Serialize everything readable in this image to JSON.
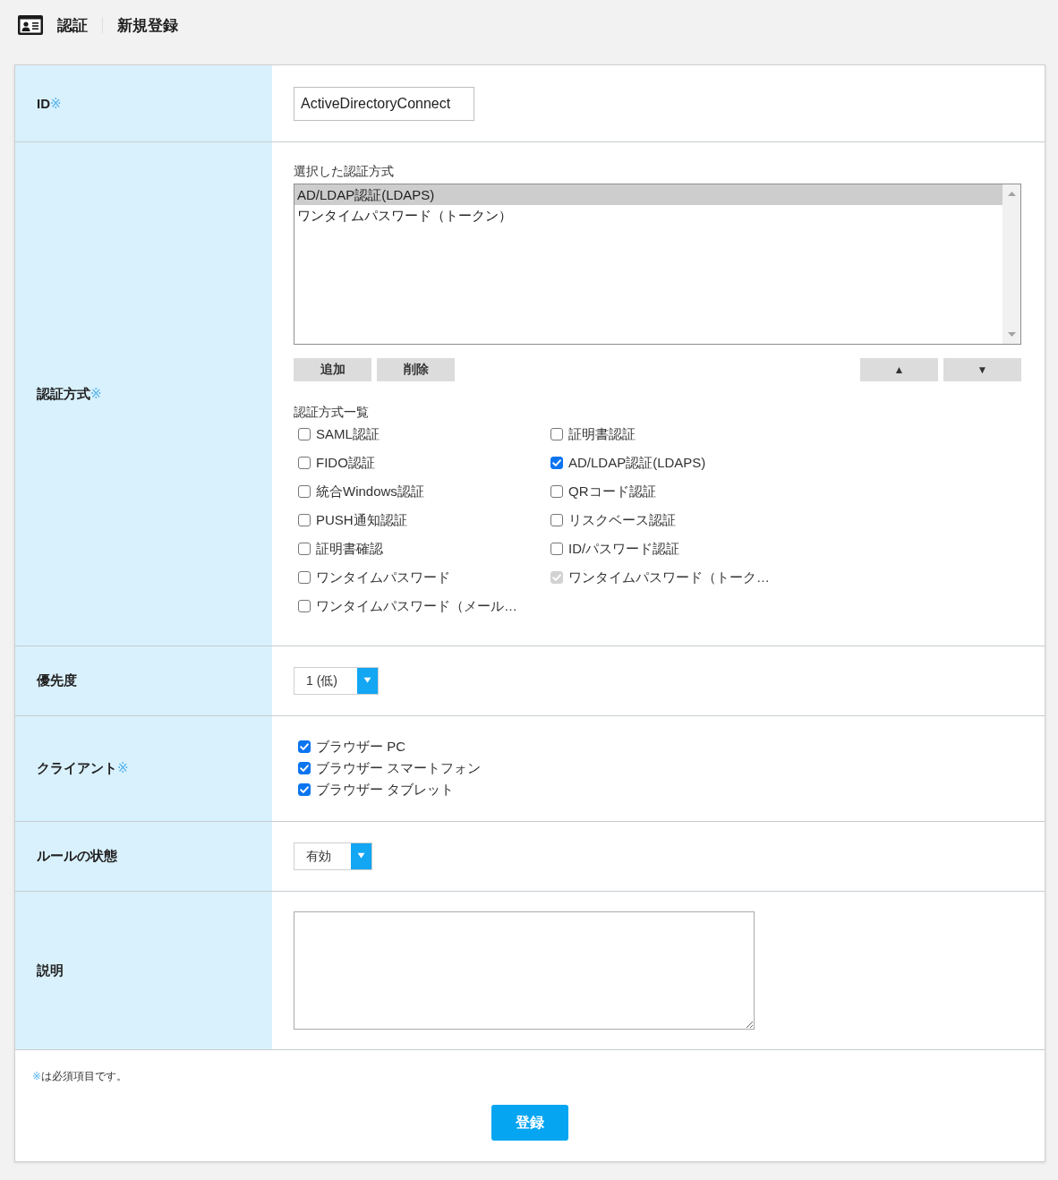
{
  "header": {
    "title": "認証",
    "subtitle": "新規登録"
  },
  "form": {
    "rows": [
      {
        "kind": "text_input",
        "label": "ID",
        "required_mark": "※",
        "value": "ActiveDirectoryConnect"
      },
      {
        "kind": "auth_methods",
        "label": "認証方式",
        "required_mark": "※",
        "selected_title": "選択した認証方式",
        "selected_methods": [
          {
            "label": "AD/LDAP認証(LDAPS)",
            "selected": true
          },
          {
            "label": "ワンタイムパスワード（トークン）",
            "selected": false
          }
        ],
        "buttons": [
          {
            "kind": "add",
            "label": "追加"
          },
          {
            "kind": "remove",
            "label": "削除"
          },
          {
            "kind": "move_up",
            "label": "▲"
          },
          {
            "kind": "move_down",
            "label": "▼"
          }
        ],
        "list_title": "認証方式一覧",
        "methods": [
          {
            "label": "SAML認証",
            "checked": false,
            "disabled": false
          },
          {
            "label": "証明書認証",
            "checked": false,
            "disabled": false
          },
          {
            "label": "FIDO認証",
            "checked": false,
            "disabled": false
          },
          {
            "label": "AD/LDAP認証(LDAPS)",
            "checked": true,
            "disabled": false
          },
          {
            "label": "統合Windows認証",
            "checked": false,
            "disabled": false
          },
          {
            "label": "QRコード認証",
            "checked": false,
            "disabled": false
          },
          {
            "label": "PUSH通知認証",
            "checked": false,
            "disabled": false
          },
          {
            "label": "リスクベース認証",
            "checked": false,
            "disabled": false
          },
          {
            "label": "証明書確認",
            "checked": false,
            "disabled": false
          },
          {
            "label": "ID/パスワード認証",
            "checked": false,
            "disabled": false
          },
          {
            "label": "ワンタイムパスワード",
            "checked": false,
            "disabled": false
          },
          {
            "label": "ワンタイムパスワード（トーク…",
            "checked": true,
            "disabled": true
          },
          {
            "label": "ワンタイムパスワード（メール…",
            "checked": false,
            "disabled": false
          }
        ]
      },
      {
        "kind": "select",
        "label": "優先度",
        "value": "1 (低)"
      },
      {
        "kind": "checkboxes",
        "label": "クライアント",
        "required_mark": "※",
        "options": [
          {
            "label": "ブラウザー PC",
            "checked": true
          },
          {
            "label": "ブラウザー スマートフォン",
            "checked": true
          },
          {
            "label": "ブラウザー タブレット",
            "checked": true
          }
        ]
      },
      {
        "kind": "select",
        "label": "ルールの状態",
        "value": "有効"
      },
      {
        "kind": "textarea",
        "label": "説明"
      }
    ]
  },
  "footer": {
    "note_mark": "※",
    "note": "は必須項目です。",
    "submit": "登録"
  }
}
